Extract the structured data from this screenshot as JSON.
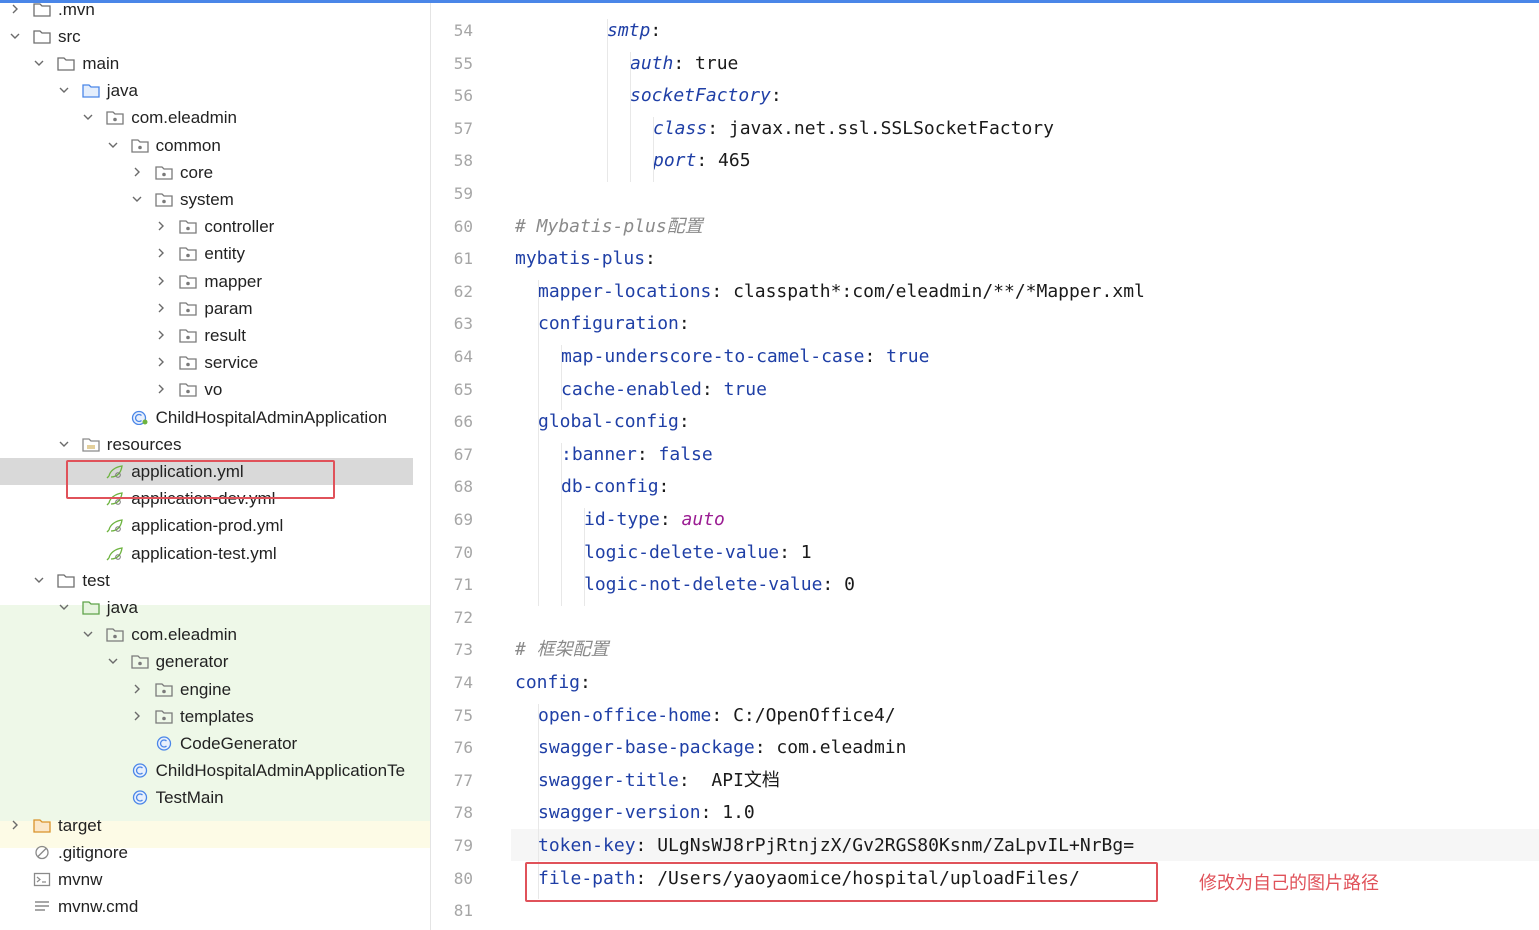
{
  "tree": [
    {
      "label": ".mvn",
      "depth": 0,
      "arrow": "right",
      "icon": "folder-icon"
    },
    {
      "label": "src",
      "depth": 0,
      "arrow": "down",
      "icon": "folder-icon"
    },
    {
      "label": "main",
      "depth": 1,
      "arrow": "down",
      "icon": "folder-icon"
    },
    {
      "label": "java",
      "depth": 2,
      "arrow": "down",
      "icon": "source-folder-icon"
    },
    {
      "label": "com.eleadmin",
      "depth": 3,
      "arrow": "down",
      "icon": "package-icon"
    },
    {
      "label": "common",
      "depth": 4,
      "arrow": "down",
      "icon": "package-icon"
    },
    {
      "label": "core",
      "depth": 5,
      "arrow": "right",
      "icon": "package-icon"
    },
    {
      "label": "system",
      "depth": 5,
      "arrow": "down",
      "icon": "package-icon"
    },
    {
      "label": "controller",
      "depth": 6,
      "arrow": "right",
      "icon": "package-icon"
    },
    {
      "label": "entity",
      "depth": 6,
      "arrow": "right",
      "icon": "package-icon"
    },
    {
      "label": "mapper",
      "depth": 6,
      "arrow": "right",
      "icon": "package-icon"
    },
    {
      "label": "param",
      "depth": 6,
      "arrow": "right",
      "icon": "package-icon"
    },
    {
      "label": "result",
      "depth": 6,
      "arrow": "right",
      "icon": "package-icon"
    },
    {
      "label": "service",
      "depth": 6,
      "arrow": "right",
      "icon": "package-icon"
    },
    {
      "label": "vo",
      "depth": 6,
      "arrow": "right",
      "icon": "package-icon"
    },
    {
      "label": "ChildHospitalAdminApplication",
      "depth": 4,
      "arrow": "none",
      "icon": "spring-class-icon"
    },
    {
      "label": "resources",
      "depth": 2,
      "arrow": "down",
      "icon": "resources-folder-icon"
    },
    {
      "label": "application.yml",
      "depth": 3,
      "arrow": "none",
      "icon": "yaml-icon",
      "selected": true
    },
    {
      "label": "application-dev.yml",
      "depth": 3,
      "arrow": "none",
      "icon": "yaml-icon"
    },
    {
      "label": "application-prod.yml",
      "depth": 3,
      "arrow": "none",
      "icon": "yaml-icon"
    },
    {
      "label": "application-test.yml",
      "depth": 3,
      "arrow": "none",
      "icon": "yaml-icon"
    },
    {
      "label": "test",
      "depth": 1,
      "arrow": "down",
      "icon": "folder-icon"
    },
    {
      "label": "java",
      "depth": 2,
      "arrow": "down",
      "icon": "test-folder-icon"
    },
    {
      "label": "com.eleadmin",
      "depth": 3,
      "arrow": "down",
      "icon": "package-icon"
    },
    {
      "label": "generator",
      "depth": 4,
      "arrow": "down",
      "icon": "package-icon"
    },
    {
      "label": "engine",
      "depth": 5,
      "arrow": "right",
      "icon": "package-icon"
    },
    {
      "label": "templates",
      "depth": 5,
      "arrow": "right",
      "icon": "package-icon"
    },
    {
      "label": "CodeGenerator",
      "depth": 5,
      "arrow": "none",
      "icon": "class-icon"
    },
    {
      "label": "ChildHospitalAdminApplicationTe",
      "depth": 4,
      "arrow": "none",
      "icon": "class-icon"
    },
    {
      "label": "TestMain",
      "depth": 4,
      "arrow": "none",
      "icon": "class-icon"
    },
    {
      "label": "target",
      "depth": 0,
      "arrow": "right",
      "icon": "excluded-folder-icon"
    },
    {
      "label": ".gitignore",
      "depth": 0,
      "arrow": "none",
      "icon": "ignore-file-icon"
    },
    {
      "label": "mvnw",
      "depth": 0,
      "arrow": "none",
      "icon": "script-file-icon"
    },
    {
      "label": "mvnw.cmd",
      "depth": 0,
      "arrow": "none",
      "icon": "text-file-icon"
    }
  ],
  "editor": {
    "lines": [
      {
        "num": "54",
        "indent": 4,
        "parts": [
          {
            "t": "smtp",
            "c": "ikey"
          },
          {
            "t": ":",
            "c": ""
          }
        ]
      },
      {
        "num": "55",
        "indent": 5,
        "parts": [
          {
            "t": "auth",
            "c": "ikey"
          },
          {
            "t": ": true",
            "c": ""
          }
        ]
      },
      {
        "num": "56",
        "indent": 5,
        "parts": [
          {
            "t": "socketFactory",
            "c": "ikey"
          },
          {
            "t": ":",
            "c": ""
          }
        ]
      },
      {
        "num": "57",
        "indent": 6,
        "parts": [
          {
            "t": "class",
            "c": "ikey"
          },
          {
            "t": ": javax.net.ssl.SSLSocketFactory",
            "c": ""
          }
        ]
      },
      {
        "num": "58",
        "indent": 6,
        "parts": [
          {
            "t": "port",
            "c": "ikey"
          },
          {
            "t": ": 465",
            "c": ""
          }
        ]
      },
      {
        "num": "59",
        "indent": 0,
        "parts": []
      },
      {
        "num": "60",
        "indent": 0,
        "parts": [
          {
            "t": "# Mybatis-plus配置",
            "c": "cmt"
          }
        ]
      },
      {
        "num": "61",
        "indent": 0,
        "parts": [
          {
            "t": "mybatis-plus",
            "c": "key"
          },
          {
            "t": ":",
            "c": ""
          }
        ]
      },
      {
        "num": "62",
        "indent": 1,
        "parts": [
          {
            "t": "mapper-locations",
            "c": "key"
          },
          {
            "t": ": classpath*:com/eleadmin/**/*Mapper.xml",
            "c": ""
          }
        ]
      },
      {
        "num": "63",
        "indent": 1,
        "parts": [
          {
            "t": "configuration",
            "c": "key"
          },
          {
            "t": ":",
            "c": ""
          }
        ]
      },
      {
        "num": "64",
        "indent": 2,
        "parts": [
          {
            "t": "map-underscore-to-camel-case",
            "c": "key"
          },
          {
            "t": ": ",
            "c": ""
          },
          {
            "t": "true",
            "c": "bool"
          }
        ]
      },
      {
        "num": "65",
        "indent": 2,
        "parts": [
          {
            "t": "cache-enabled",
            "c": "key"
          },
          {
            "t": ": ",
            "c": ""
          },
          {
            "t": "true",
            "c": "bool"
          }
        ]
      },
      {
        "num": "66",
        "indent": 1,
        "parts": [
          {
            "t": "global-config",
            "c": "key"
          },
          {
            "t": ":",
            "c": ""
          }
        ]
      },
      {
        "num": "67",
        "indent": 2,
        "parts": [
          {
            "t": ":banner",
            "c": "key"
          },
          {
            "t": ": ",
            "c": ""
          },
          {
            "t": "false",
            "c": "bool"
          }
        ]
      },
      {
        "num": "68",
        "indent": 2,
        "parts": [
          {
            "t": "db-config",
            "c": "key"
          },
          {
            "t": ":",
            "c": ""
          }
        ]
      },
      {
        "num": "69",
        "indent": 3,
        "parts": [
          {
            "t": "id-type",
            "c": "key"
          },
          {
            "t": ": ",
            "c": ""
          },
          {
            "t": "auto",
            "c": "auto"
          }
        ]
      },
      {
        "num": "70",
        "indent": 3,
        "parts": [
          {
            "t": "logic-delete-value",
            "c": "key"
          },
          {
            "t": ": 1",
            "c": ""
          }
        ]
      },
      {
        "num": "71",
        "indent": 3,
        "parts": [
          {
            "t": "logic-not-delete-value",
            "c": "key"
          },
          {
            "t": ": 0",
            "c": ""
          }
        ]
      },
      {
        "num": "72",
        "indent": 0,
        "parts": []
      },
      {
        "num": "73",
        "indent": 0,
        "parts": [
          {
            "t": "# 框架配置",
            "c": "cmt"
          }
        ]
      },
      {
        "num": "74",
        "indent": 0,
        "parts": [
          {
            "t": "config",
            "c": "key"
          },
          {
            "t": ":",
            "c": ""
          }
        ]
      },
      {
        "num": "75",
        "indent": 1,
        "parts": [
          {
            "t": "open-office-home",
            "c": "key"
          },
          {
            "t": ": C:/OpenOffice4/",
            "c": ""
          }
        ]
      },
      {
        "num": "76",
        "indent": 1,
        "parts": [
          {
            "t": "swagger-base-package",
            "c": "key"
          },
          {
            "t": ": com.eleadmin",
            "c": ""
          }
        ]
      },
      {
        "num": "77",
        "indent": 1,
        "parts": [
          {
            "t": "swagger-title",
            "c": "key"
          },
          {
            "t": ":  API文档",
            "c": ""
          }
        ]
      },
      {
        "num": "78",
        "indent": 1,
        "parts": [
          {
            "t": "swagger-version",
            "c": "key"
          },
          {
            "t": ": 1.0",
            "c": ""
          }
        ]
      },
      {
        "num": "79",
        "indent": 1,
        "parts": [
          {
            "t": "token-key",
            "c": "key"
          },
          {
            "t": ": ULgNsWJ8rPjRtnjzX/Gv2RGS80Ksnm/ZaLpvIL+NrBg=",
            "c": ""
          }
        ]
      },
      {
        "num": "80",
        "indent": 1,
        "parts": [
          {
            "t": "file-path",
            "c": "key"
          },
          {
            "t": ": /Users/yaoyaomice/hospital/uploadFiles/",
            "c": ""
          }
        ]
      },
      {
        "num": "81",
        "indent": 0,
        "parts": []
      }
    ]
  },
  "annotation": "修改为自己的图片路径",
  "colors": {
    "accent": "#4a86e8",
    "highlight": "#e0525a",
    "key": "#1f3fa6"
  }
}
